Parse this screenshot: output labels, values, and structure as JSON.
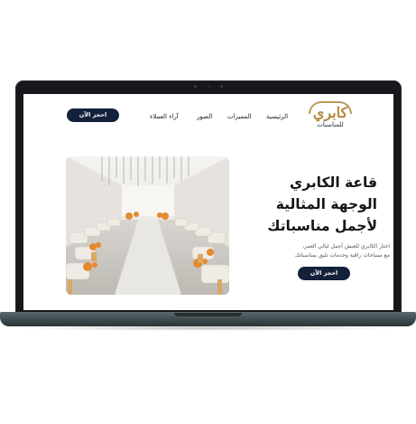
{
  "nav": {
    "logo_main": "كابري",
    "logo_sub": "للمناسبات",
    "links": [
      "الرئيسية",
      "المميزات",
      "الصور",
      "آراء العملاء"
    ],
    "book_button": "احجز الآن"
  },
  "hero": {
    "title_line1": "قاعة الكابري",
    "title_line2": "الوجهة المثالية",
    "title_line3": "لأجمل مناسباتك",
    "desc_line1": "اختار الكابري للعيش أجمل ليالي العمر،",
    "desc_line2": "مع مساحات راقية وخدمات تليق بمناسباتك",
    "cta_button": "احجز الآن"
  },
  "colors": {
    "gold": "#b08a3e",
    "navy": "#13213a",
    "bezel": "#17181b",
    "base": "#3d4a4e"
  }
}
